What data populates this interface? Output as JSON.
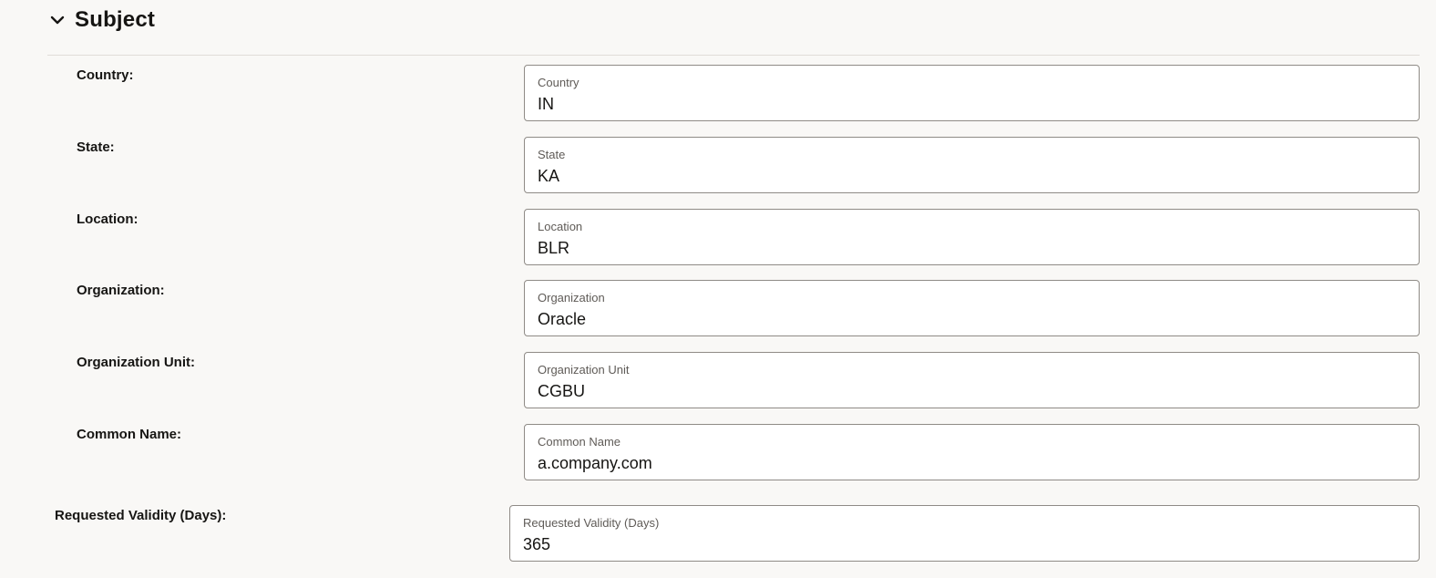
{
  "section": {
    "title": "Subject",
    "expanded": true,
    "icon": "chevron-down-icon"
  },
  "fields": [
    {
      "row_label": "Country:",
      "field_label": "Country",
      "value": "IN"
    },
    {
      "row_label": "State:",
      "field_label": "State",
      "value": "KA"
    },
    {
      "row_label": "Location:",
      "field_label": "Location",
      "value": "BLR"
    },
    {
      "row_label": "Organization:",
      "field_label": "Organization",
      "value": "Oracle"
    },
    {
      "row_label": "Organization Unit:",
      "field_label": "Organization Unit",
      "value": "CGBU"
    },
    {
      "row_label": "Common Name:",
      "field_label": "Common Name",
      "value": "a.company.com"
    }
  ],
  "validity": {
    "row_label": "Requested Validity (Days):",
    "field_label": "Requested Validity (Days)",
    "value": "365"
  },
  "colors": {
    "background": "#f9f8f6",
    "field_border": "#8f8b86",
    "field_label": "#5f5b57",
    "text": "#161513"
  }
}
